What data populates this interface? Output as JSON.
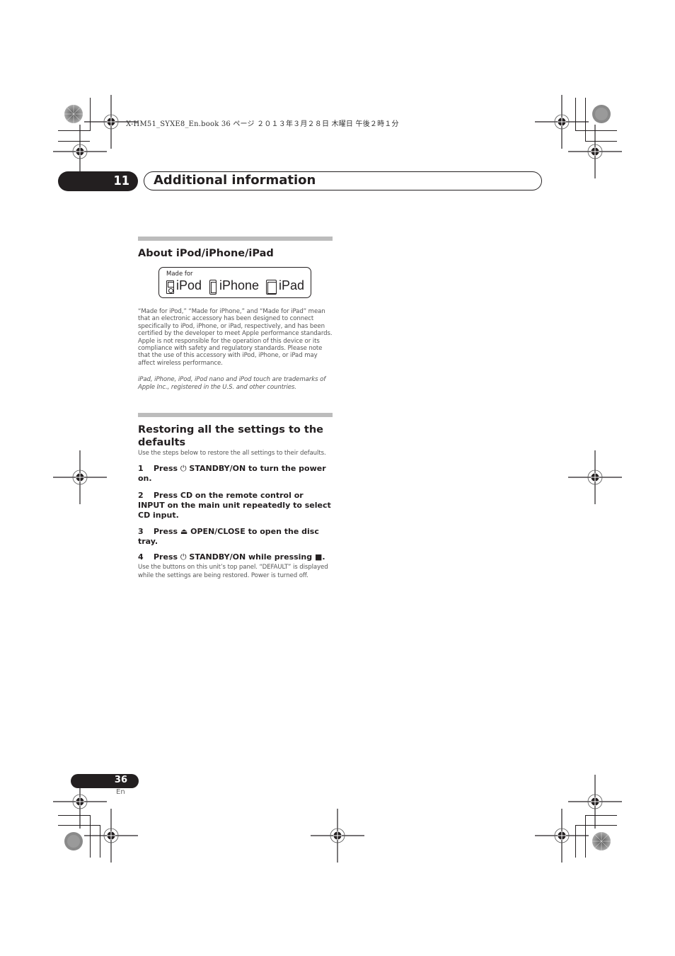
{
  "print_slug": "X-HM51_SYXE8_En.book  36 ページ  ２０１３年３月２８日  木曜日  午後２時１分",
  "chapter": {
    "number": "11",
    "title": "Additional information"
  },
  "section_ipod": {
    "heading": "About iPod/iPhone/iPad",
    "badge": {
      "made_for": "Made for",
      "products": [
        "iPod",
        "iPhone",
        "iPad"
      ],
      "icons": [
        "ipod-icon",
        "iphone-icon",
        "ipad-icon"
      ]
    },
    "paragraph": "“Made for iPod,” “Made for iPhone,” and “Made for iPad” mean that an electronic accessory has been designed to connect specifically to iPod, iPhone, or iPad, respectively, and has been certified by the developer to meet Apple performance standards. Apple is not responsible for the operation of this device or its compliance with safety and regulatory standards. Please note that the use of this accessory with iPod, iPhone, or iPad may affect wireless performance.",
    "trademark": "iPad, iPhone, iPod, iPod nano and iPod touch are trademarks of Apple Inc., registered in the U.S. and other countries."
  },
  "section_restore": {
    "heading": "Restoring all the settings to the defaults",
    "intro": "Use the steps below to restore the all settings to their defaults.",
    "steps": [
      {
        "num": "1",
        "pre": "Press ",
        "icon": "power-icon",
        "text": " STANDBY/ON to turn the power on."
      },
      {
        "num": "2",
        "pre": "Press CD on the remote control or INPUT on the main unit repeatedly to select CD input.",
        "icon": "",
        "text": ""
      },
      {
        "num": "3",
        "pre": "Press ",
        "icon": "eject-icon",
        "text": " OPEN/CLOSE to open the disc tray."
      },
      {
        "num": "4",
        "pre": "Press ",
        "icon": "power-icon",
        "text": " STANDBY/ON while pressing ■."
      }
    ],
    "step4_note": "Use the buttons on this unit’s top panel. “DEFAULT” is displayed while the settings are being restored. Power is turned off."
  },
  "footer": {
    "page_number": "36",
    "language": "En"
  }
}
